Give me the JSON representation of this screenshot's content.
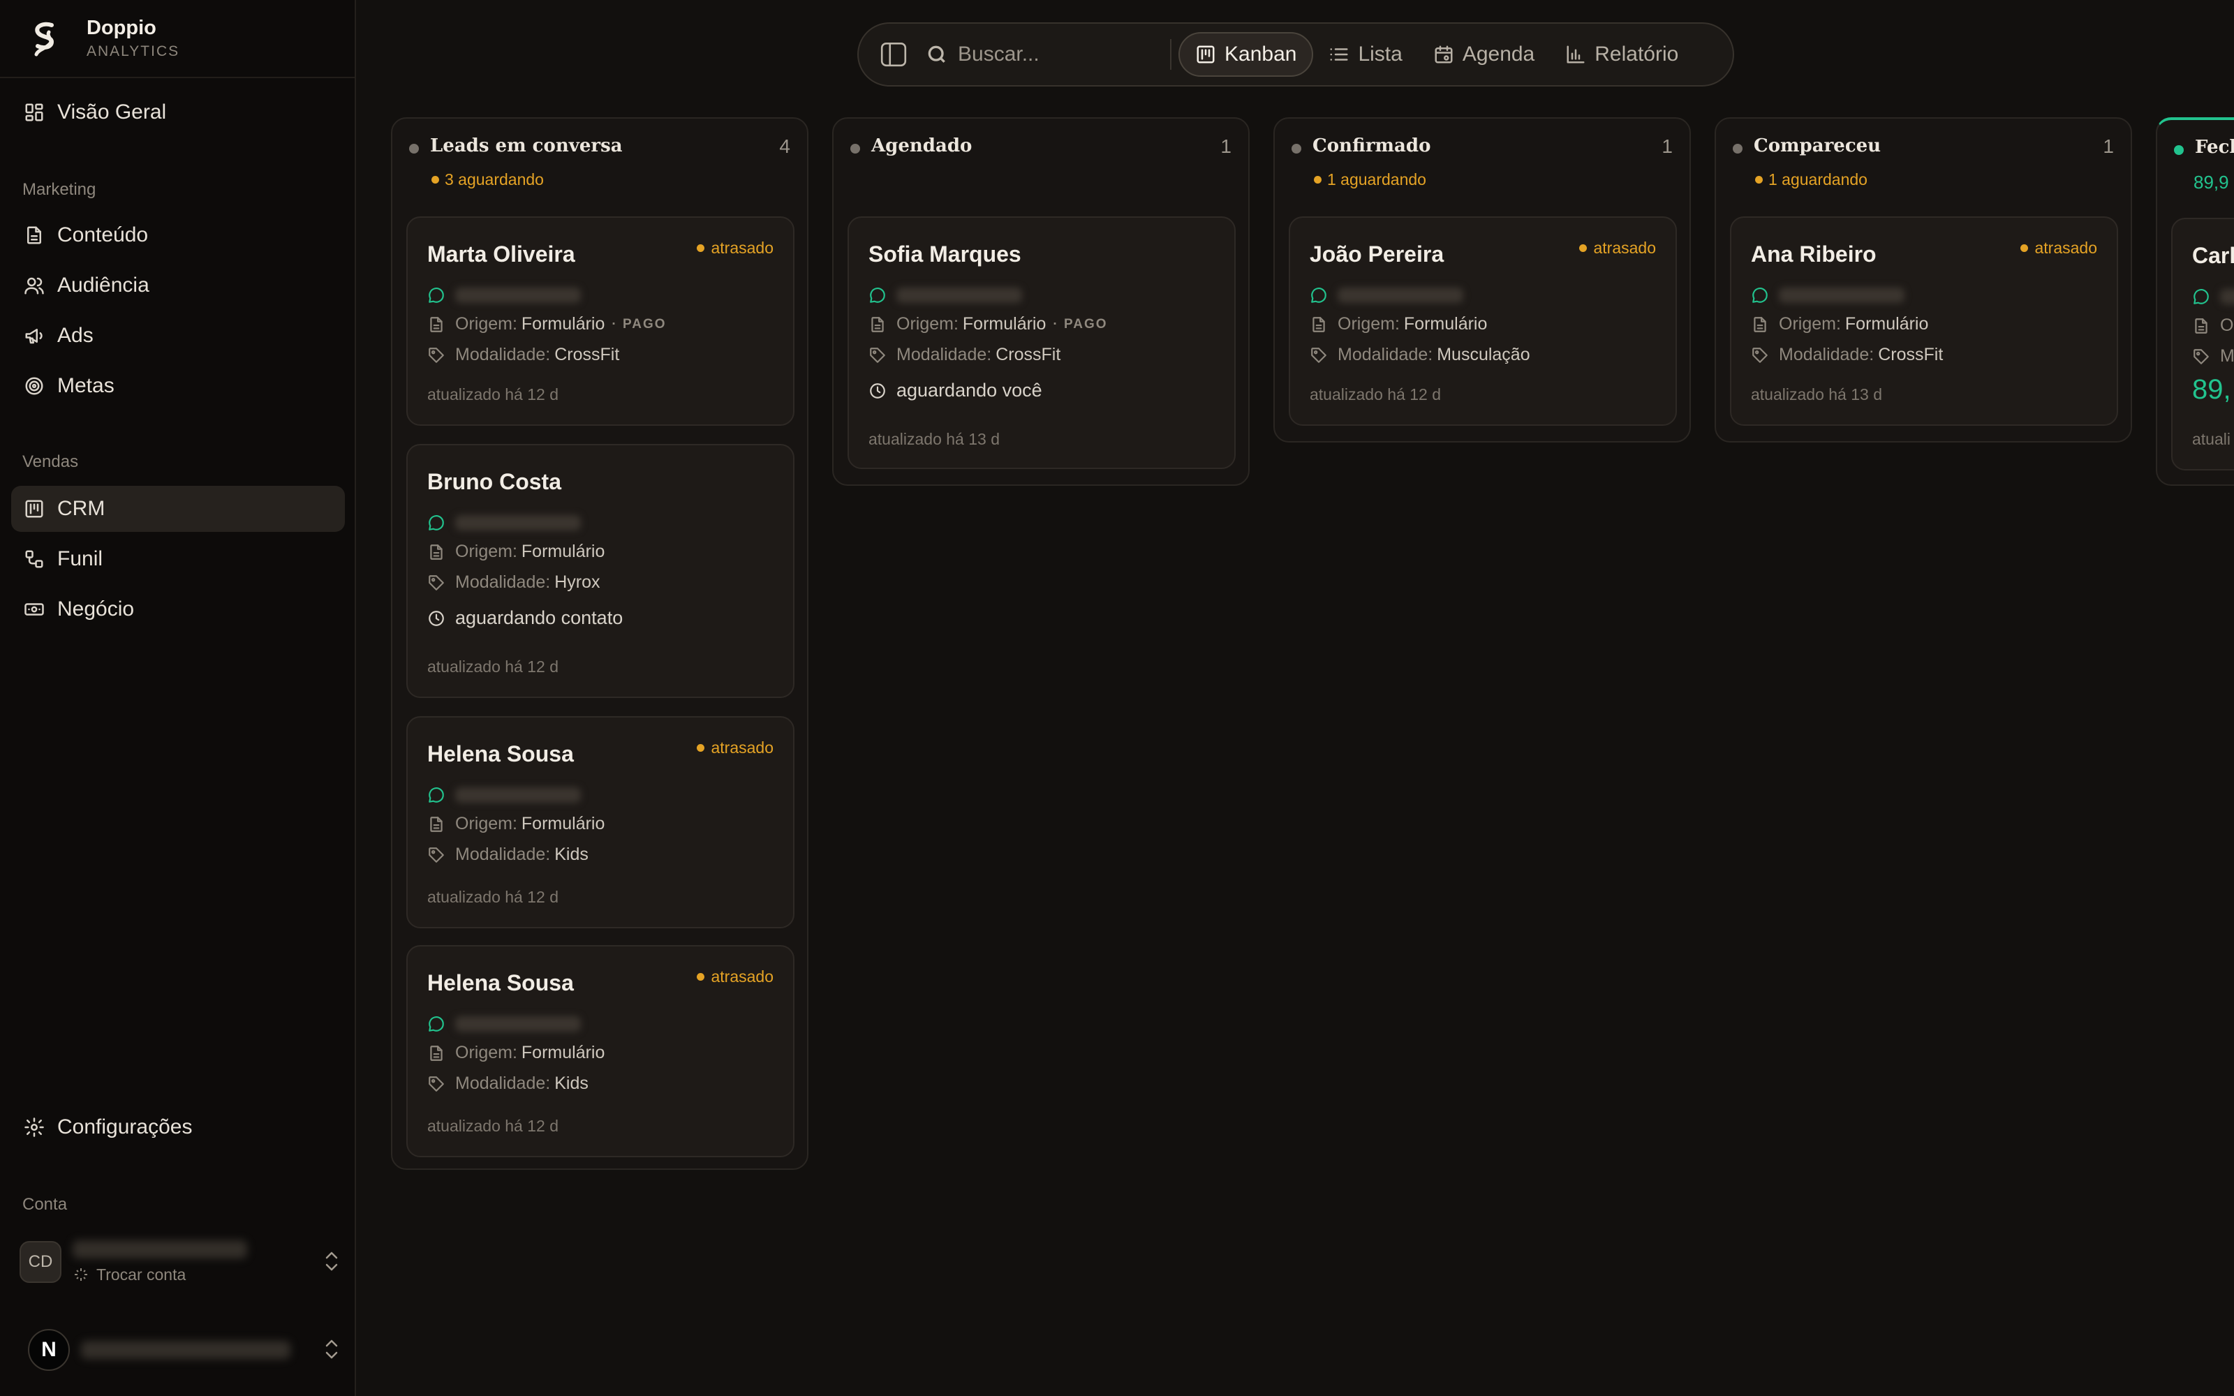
{
  "brand": {
    "name": "Doppio",
    "subtitle": "ANALYTICS"
  },
  "sidebar": {
    "overview": {
      "label": "Visão Geral",
      "icon": "grid-icon"
    },
    "marketing_title": "Marketing",
    "marketing": [
      {
        "label": "Conteúdo",
        "icon": "document-icon"
      },
      {
        "label": "Audiência",
        "icon": "users-icon"
      },
      {
        "label": "Ads",
        "icon": "megaphone-icon"
      },
      {
        "label": "Metas",
        "icon": "target-icon"
      }
    ],
    "sales_title": "Vendas",
    "sales": [
      {
        "label": "CRM",
        "icon": "kanban-icon",
        "active": true
      },
      {
        "label": "Funil",
        "icon": "funnel-icon"
      },
      {
        "label": "Negócio",
        "icon": "money-icon"
      }
    ],
    "settings": {
      "label": "Configurações",
      "icon": "gear-icon"
    },
    "account_title": "Conta",
    "account": {
      "initials": "CD",
      "switch_label": "Trocar conta"
    },
    "user": {
      "initial": "N"
    }
  },
  "toolbar": {
    "search_placeholder": "Buscar...",
    "tabs": [
      {
        "label": "Kanban",
        "icon": "kanban-icon",
        "active": true
      },
      {
        "label": "Lista",
        "icon": "list-icon"
      },
      {
        "label": "Agenda",
        "icon": "calendar-icon"
      },
      {
        "label": "Relatório",
        "icon": "bar-chart-icon"
      }
    ]
  },
  "colors": {
    "accent_amber": "#e5a325",
    "accent_green": "#22c38e",
    "background": "#12100e"
  },
  "board": {
    "columns": [
      {
        "title": "Leads em conversa",
        "count": "4",
        "sub": "3 aguardando",
        "cards": [
          {
            "name": "Marta Oliveira",
            "flag": "atrasado",
            "origin_label": "Origem:",
            "origin": "Formulário",
            "paid": "· PAGO",
            "mod_label": "Modalidade:",
            "modality": "CrossFit",
            "updated": "atualizado há 12 d"
          },
          {
            "name": "Bruno Costa",
            "origin_label": "Origem:",
            "origin": "Formulário",
            "mod_label": "Modalidade:",
            "modality": "Hyrox",
            "waiting": "aguardando contato",
            "updated": "atualizado há 12 d"
          },
          {
            "name": "Helena Sousa",
            "flag": "atrasado",
            "origin_label": "Origem:",
            "origin": "Formulário",
            "mod_label": "Modalidade:",
            "modality": "Kids",
            "updated": "atualizado há 12 d"
          },
          {
            "name": "Helena Sousa",
            "flag": "atrasado",
            "origin_label": "Origem:",
            "origin": "Formulário",
            "mod_label": "Modalidade:",
            "modality": "Kids",
            "updated": "atualizado há 12 d"
          }
        ]
      },
      {
        "title": "Agendado",
        "count": "1",
        "sub": "",
        "cards": [
          {
            "name": "Sofia Marques",
            "origin_label": "Origem:",
            "origin": "Formulário",
            "paid": "· PAGO",
            "mod_label": "Modalidade:",
            "modality": "CrossFit",
            "waiting": "aguardando você",
            "updated": "atualizado há 13 d"
          }
        ]
      },
      {
        "title": "Confirmado",
        "count": "1",
        "sub": "1 aguardando",
        "cards": [
          {
            "name": "João Pereira",
            "flag": "atrasado",
            "origin_label": "Origem:",
            "origin": "Formulário",
            "mod_label": "Modalidade:",
            "modality": "Musculação",
            "updated": "atualizado há 12 d"
          }
        ]
      },
      {
        "title": "Compareceu",
        "count": "1",
        "sub": "1 aguardando",
        "cards": [
          {
            "name": "Ana Ribeiro",
            "flag": "atrasado",
            "origin_label": "Origem:",
            "origin": "Formulário",
            "mod_label": "Modalidade:",
            "modality": "CrossFit",
            "updated": "atualizado há 13 d"
          }
        ]
      },
      {
        "title": "Fech",
        "sub": "89,9",
        "cards": [
          {
            "name": "Carl",
            "origin_label": "O",
            "mod_label": "M",
            "amount": "89,",
            "updated": "atuali"
          }
        ]
      }
    ]
  }
}
